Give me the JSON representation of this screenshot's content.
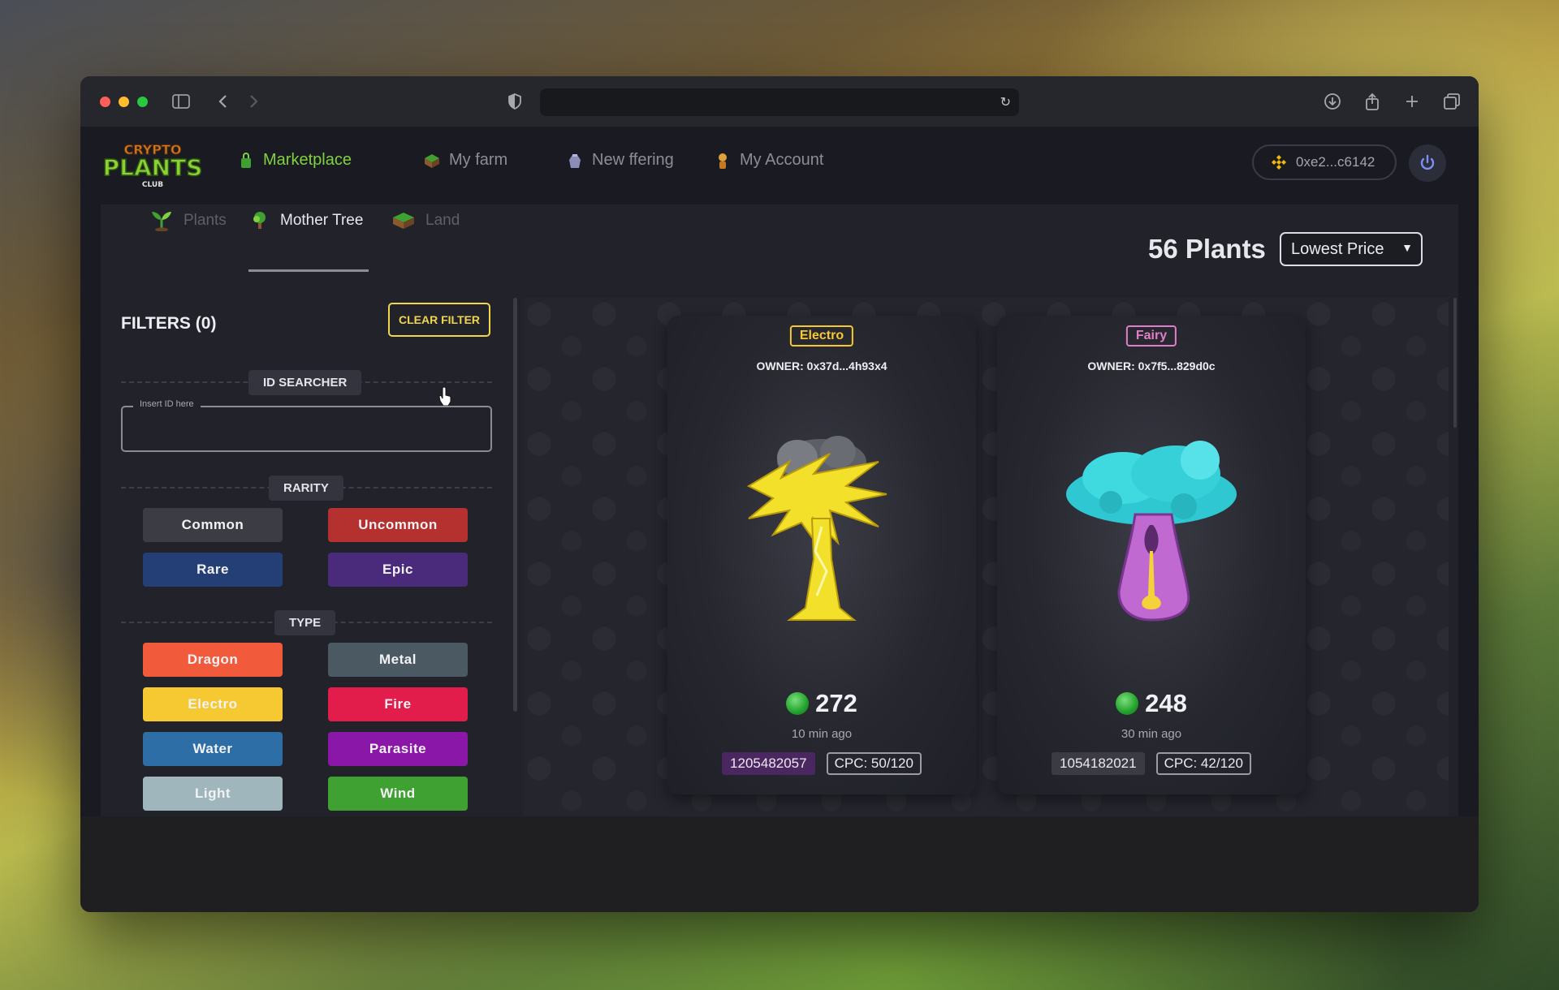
{
  "browser": {
    "url": ""
  },
  "nav": {
    "logo_text": "CRYPTO PLANTS CLUB",
    "items": [
      {
        "label": "Marketplace",
        "active": true
      },
      {
        "label": "My farm",
        "active": false
      },
      {
        "label": "New ffering",
        "active": false
      },
      {
        "label": "My Account",
        "active": false
      }
    ],
    "wallet": "0xe2...c6142"
  },
  "tabs": [
    {
      "label": "Plants",
      "active": false
    },
    {
      "label": "Mother Tree",
      "active": true
    },
    {
      "label": "Land",
      "active": false
    }
  ],
  "header": {
    "count": "56 Plants",
    "sort": "Lowest Price"
  },
  "filters": {
    "title": "FILTERS (0)",
    "clear": "CLEAR FILTER",
    "id_section": "ID SEARCHER",
    "id_placeholder": "Insert ID here",
    "rarity_section": "RARITY",
    "rarity": [
      {
        "label": "Common",
        "color": "#3c3d44"
      },
      {
        "label": "Uncommon",
        "color": "#b43130"
      },
      {
        "label": "Rare",
        "color": "#243f75"
      },
      {
        "label": "Epic",
        "color": "#4a2a7a"
      }
    ],
    "type_section": "TYPE",
    "types": [
      {
        "label": "Dragon",
        "color": "#f15b3c"
      },
      {
        "label": "Metal",
        "color": "#4b5a62"
      },
      {
        "label": "Electro",
        "color": "#f6c832"
      },
      {
        "label": "Fire",
        "color": "#e21c4b"
      },
      {
        "label": "Water",
        "color": "#2d6ea6"
      },
      {
        "label": "Parasite",
        "color": "#8a17a8"
      },
      {
        "label": "Light",
        "color": "#9fb6bd"
      },
      {
        "label": "Wind",
        "color": "#3fa131"
      }
    ]
  },
  "cards": [
    {
      "type": "Electro",
      "type_color": "#f6c832",
      "owner": "OWNER: 0x37d...4h93x4",
      "price": "272",
      "time": "10 min ago",
      "id": "1205482057",
      "cpc": "CPC: 50/120"
    },
    {
      "type": "Fairy",
      "type_color": "#e07fc8",
      "owner": "OWNER: 0x7f5...829d0c",
      "price": "248",
      "time": "30 min ago",
      "id": "1054182021",
      "cpc": "CPC: 42/120"
    }
  ]
}
